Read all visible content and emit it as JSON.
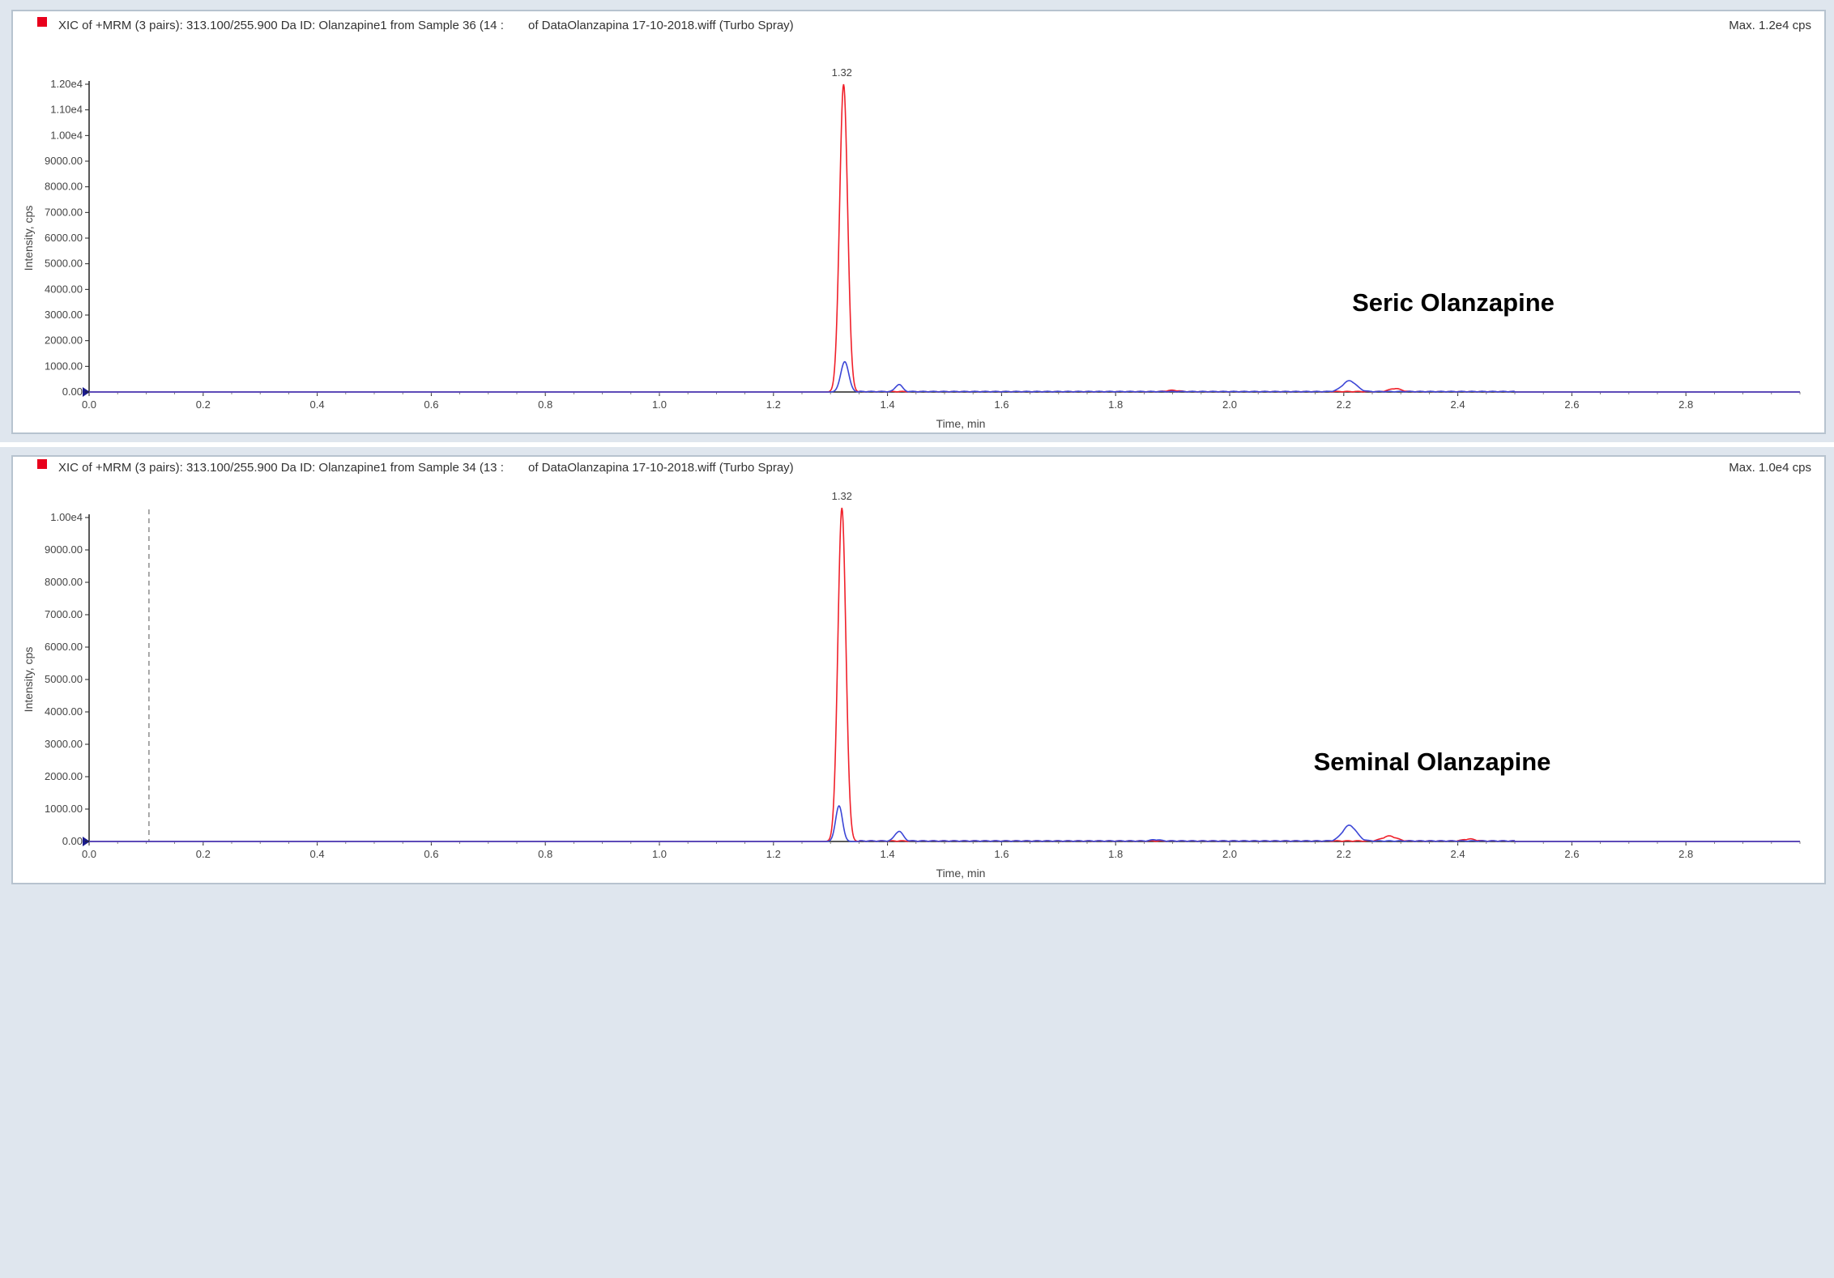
{
  "colors": {
    "red_series": "#f0202a",
    "blue_series": "#3c46d6",
    "axis": "#222222",
    "panel_bg": "#dfe6ee",
    "legend_marker": "#e8001c"
  },
  "chart_data": [
    {
      "type": "line",
      "header": "XIC of +MRM (3 pairs): 313.100/255.900 Da ID: Olanzapine1 from Sample 36 (14 :",
      "header_file": "of DataOlanzapina 17-10-2018.wiff (Turbo Spray)",
      "max_label": "Max. 1.2e4 cps",
      "annotation": "Seric Olanzapine",
      "peak_label": "1.32",
      "peak_label_x": 1.32,
      "ylabel": "Intensity, cps",
      "xlabel": "Time, min",
      "xlim": [
        0.0,
        3.0
      ],
      "ylim": [
        0,
        12000
      ],
      "x_ticks": [
        "0.0",
        "0.2",
        "0.4",
        "0.6",
        "0.8",
        "1.0",
        "1.2",
        "1.4",
        "1.6",
        "1.8",
        "2.0",
        "2.2",
        "2.4",
        "2.6",
        "2.8"
      ],
      "y_ticks": [
        {
          "v": 0,
          "label": "0.00"
        },
        {
          "v": 1000,
          "label": "1000.00"
        },
        {
          "v": 2000,
          "label": "2000.00"
        },
        {
          "v": 3000,
          "label": "3000.00"
        },
        {
          "v": 4000,
          "label": "4000.00"
        },
        {
          "v": 5000,
          "label": "5000.00"
        },
        {
          "v": 6000,
          "label": "6000.00"
        },
        {
          "v": 7000,
          "label": "7000.00"
        },
        {
          "v": 8000,
          "label": "8000.00"
        },
        {
          "v": 9000,
          "label": "9000.00"
        },
        {
          "v": 10000,
          "label": "1.00e4"
        },
        {
          "v": 11000,
          "label": "1.10e4"
        },
        {
          "v": 12000,
          "label": "1.20e4"
        }
      ],
      "series": [
        {
          "color": "#f0202a",
          "peaks": [
            [
              1.323,
              12000,
              0.007
            ],
            [
              2.29,
              120,
              0.01
            ],
            [
              1.9,
              50,
              0.01
            ]
          ]
        },
        {
          "color": "#3c46d6",
          "peaks": [
            [
              1.325,
              1180,
              0.007
            ],
            [
              1.42,
              280,
              0.006
            ],
            [
              2.21,
              420,
              0.012
            ]
          ]
        }
      ],
      "dashed_marker_x": null
    },
    {
      "type": "line",
      "header": "XIC of +MRM (3 pairs): 313.100/255.900 Da ID: Olanzapine1 from Sample 34 (13 :",
      "header_file": "of DataOlanzapina 17-10-2018.wiff (Turbo Spray)",
      "max_label": "Max. 1.0e4 cps",
      "annotation": "Seminal Olanzapine",
      "peak_label": "1.32",
      "peak_label_x": 1.32,
      "ylabel": "Intensity, cps",
      "xlabel": "Time, min",
      "xlim": [
        0.0,
        3.0
      ],
      "ylim": [
        0,
        10000
      ],
      "x_ticks": [
        "0.0",
        "0.2",
        "0.4",
        "0.6",
        "0.8",
        "1.0",
        "1.2",
        "1.4",
        "1.6",
        "1.8",
        "2.0",
        "2.2",
        "2.4",
        "2.6",
        "2.8"
      ],
      "y_ticks": [
        {
          "v": 0,
          "label": "0.00"
        },
        {
          "v": 1000,
          "label": "1000.00"
        },
        {
          "v": 2000,
          "label": "2000.00"
        },
        {
          "v": 3000,
          "label": "3000.00"
        },
        {
          "v": 4000,
          "label": "4000.00"
        },
        {
          "v": 5000,
          "label": "5000.00"
        },
        {
          "v": 6000,
          "label": "6000.00"
        },
        {
          "v": 7000,
          "label": "7000.00"
        },
        {
          "v": 8000,
          "label": "8000.00"
        },
        {
          "v": 9000,
          "label": "9000.00"
        },
        {
          "v": 10000,
          "label": "1.00e4"
        }
      ],
      "series": [
        {
          "color": "#f0202a",
          "peaks": [
            [
              1.32,
              10300,
              0.007
            ],
            [
              2.28,
              150,
              0.012
            ],
            [
              2.42,
              60,
              0.01
            ]
          ]
        },
        {
          "color": "#3c46d6",
          "peaks": [
            [
              1.315,
              1100,
              0.006
            ],
            [
              1.42,
              300,
              0.007
            ],
            [
              2.21,
              480,
              0.012
            ],
            [
              1.87,
              40,
              0.008
            ]
          ]
        }
      ],
      "dashed_marker_x": 0.105
    }
  ]
}
